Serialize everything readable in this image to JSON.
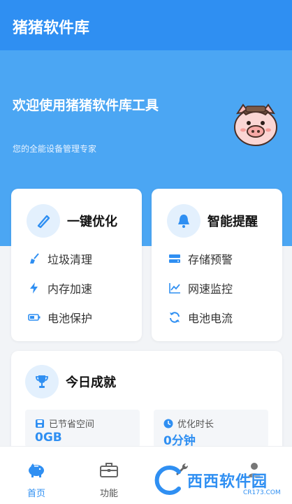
{
  "header": {
    "title": "猪猪软件库"
  },
  "hero": {
    "welcome": "欢迎使用猪猪软件库工具",
    "subtitle": "您的全能设备管理专家",
    "mascot_icon": "pig-mascot-icon"
  },
  "optimize_card": {
    "title": "一键优化",
    "icon": "brush-icon",
    "items": [
      {
        "label": "垃圾清理",
        "icon": "broom-icon"
      },
      {
        "label": "内存加速",
        "icon": "lightning-icon"
      },
      {
        "label": "电池保护",
        "icon": "battery-icon"
      }
    ]
  },
  "reminder_card": {
    "title": "智能提醒",
    "icon": "bell-icon",
    "items": [
      {
        "label": "存储预警",
        "icon": "storage-icon"
      },
      {
        "label": "网速监控",
        "icon": "line-chart-icon"
      },
      {
        "label": "电池电流",
        "icon": "refresh-icon"
      }
    ]
  },
  "achievement_card": {
    "title": "今日成就",
    "icon": "trophy-icon",
    "stats": [
      {
        "label": "已节省空间",
        "value": "0GB",
        "icon": "save-icon"
      },
      {
        "label": "优化时长",
        "value": "0分钟",
        "icon": "clock-icon"
      }
    ]
  },
  "bottom_nav": {
    "items": [
      {
        "label": "首页",
        "icon": "piggy-bank-icon",
        "active": true
      },
      {
        "label": "功能",
        "icon": "toolbox-icon",
        "active": false
      },
      {
        "label": "",
        "icon": "wrench-icon",
        "active": false
      },
      {
        "label": "",
        "icon": "user-icon",
        "active": false
      }
    ]
  },
  "watermark": {
    "text": "西西软件园",
    "url": "CR173.COM"
  },
  "colors": {
    "primary": "#2f8ff2",
    "hero": "#4ba6f3",
    "icon_bg": "#e3f0fd"
  }
}
